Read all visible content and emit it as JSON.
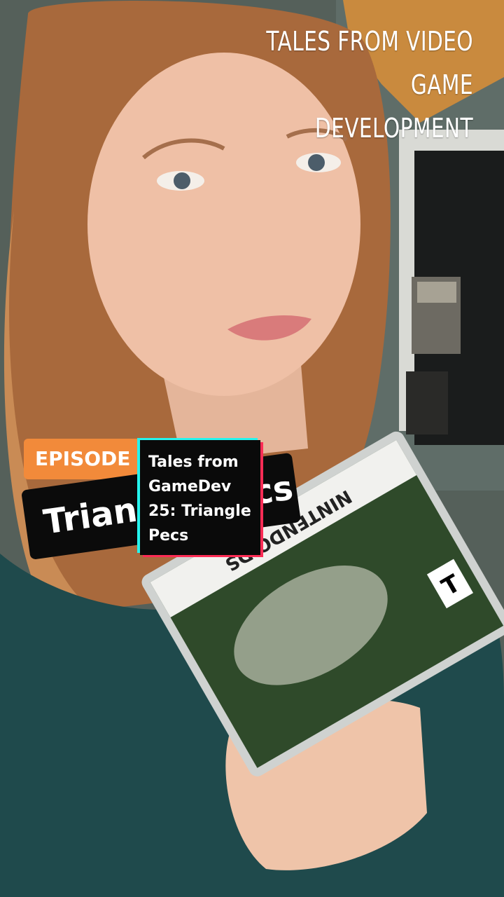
{
  "overlay": {
    "title_line1": "TALES FROM VIDEO",
    "title_line2": "GAME DEVELOPMENT"
  },
  "badges": {
    "episode_label": "EPISODE 2",
    "title_label": "Triangle Pecs"
  },
  "caption": {
    "line1": "Tales from",
    "line2": "GameDev",
    "line3": "25: Triangle",
    "line4": "Pecs"
  },
  "game_case": {
    "platform_label": "NINTENDO DS",
    "rating_label": "T"
  },
  "colors": {
    "accent_orange": "#f28a3a",
    "caption_cyan": "#25f4ee",
    "caption_red": "#fe2c55"
  }
}
